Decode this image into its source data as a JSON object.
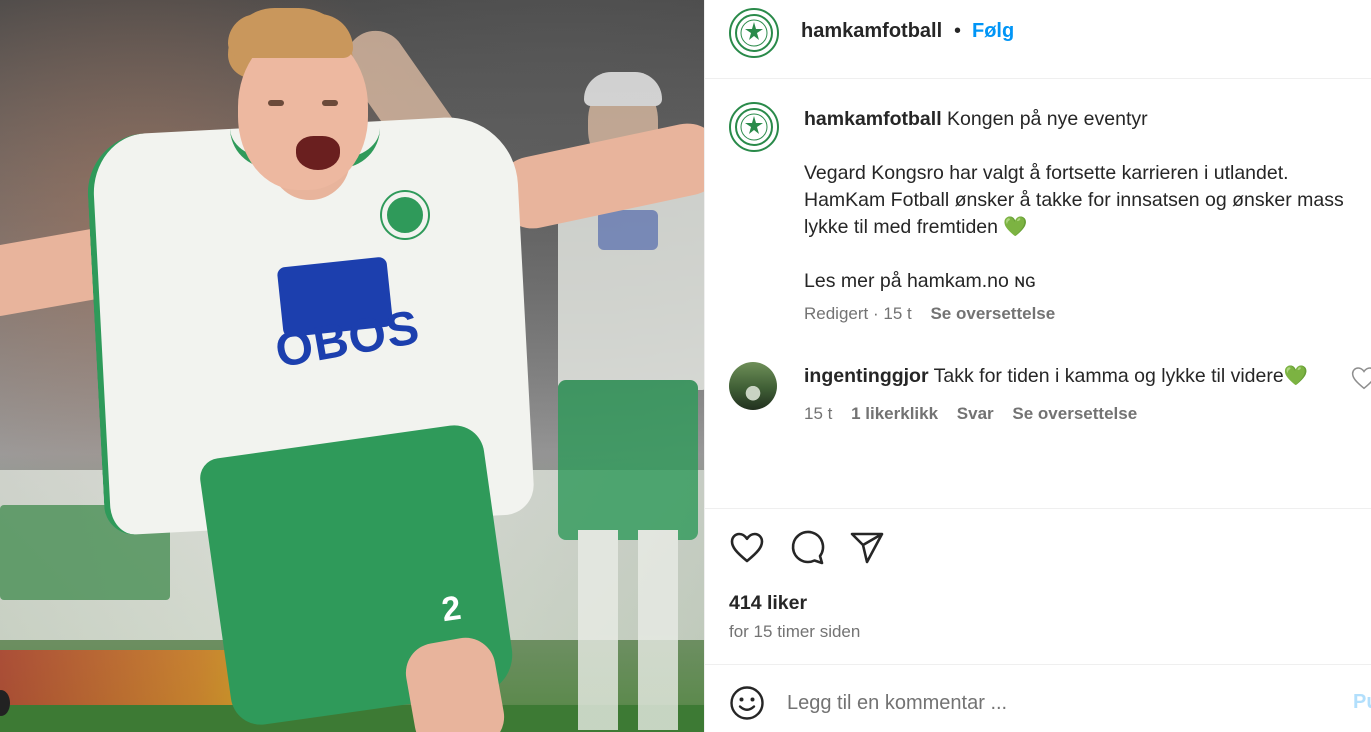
{
  "post": {
    "author": "hamkamfotball",
    "follow_label": "Følg",
    "separator": "•",
    "caption_title": "Kongen på nye eventyr",
    "caption_line1": "Vegard Kongsro har valgt å fortsette karrieren i utlandet.",
    "caption_line2": "HamKam Fotball ønsker å takke for innsatsen og ønsker mass",
    "caption_line3": "lykke til med fremtiden 💚",
    "caption_line4": "Les mer på hamkam.no ɴɢ",
    "meta_edited": "Redigert · 15 t",
    "meta_translate": "Se oversettelse"
  },
  "comment": {
    "author": "ingentinggjor",
    "text": "Takk for tiden i kamma og lykke til videre💚",
    "time": "15 t",
    "likes": "1 likerklikk",
    "reply": "Svar",
    "translate": "Se oversettelse"
  },
  "stats": {
    "likes": "414 liker",
    "time": "for 15 timer siden"
  },
  "composer": {
    "placeholder": "Legg til en kommentar ...",
    "post_label": "Publiser"
  },
  "photo": {
    "shirt_sponsor": "OBOS",
    "shirt_number": "2"
  },
  "icons": {
    "avatar": "hamkam-crest-icon",
    "like": "heart-icon",
    "comment": "comment-bubble-icon",
    "share": "paper-plane-icon",
    "emoji": "smiley-icon",
    "comment_like": "heart-outline-icon"
  },
  "colors": {
    "accent": "#0095f6",
    "brand_green": "#2a8a4a",
    "muted": "#737373"
  }
}
